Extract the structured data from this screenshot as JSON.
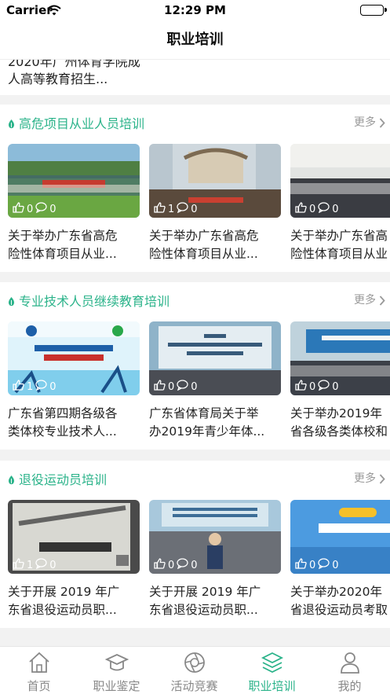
{
  "status_bar": {
    "carrier": "Carrier",
    "time": "12:29 PM"
  },
  "navbar": {
    "title": "职业培训"
  },
  "top_card": {
    "text": "2020年广州体育学院成人高等教育招生..."
  },
  "more_label": "更多",
  "sections": [
    {
      "title": "高危项目从业人员培训",
      "cards": [
        {
          "likes": "0",
          "comments": "0",
          "caption_1": "关于举办广东省高危",
          "caption_2": "险性体育项目从业..."
        },
        {
          "likes": "1",
          "comments": "0",
          "caption_1": "关于举办广东省高危",
          "caption_2": "险性体育项目从业..."
        },
        {
          "likes": "0",
          "comments": "0",
          "caption_1": "关于举办广东省高",
          "caption_2": "险性体育项目从业"
        }
      ]
    },
    {
      "title": "专业技术人员继续教育培训",
      "cards": [
        {
          "likes": "1",
          "comments": "0",
          "caption_1": "广东省第四期各级各",
          "caption_2": "类体校专业技术人..."
        },
        {
          "likes": "0",
          "comments": "0",
          "caption_1": "广东省体育局关于举",
          "caption_2": "办2019年青少年体..."
        },
        {
          "likes": "0",
          "comments": "0",
          "caption_1": "关于举办2019年",
          "caption_2": "省各级各类体校和"
        }
      ]
    },
    {
      "title": "退役运动员培训",
      "cards": [
        {
          "likes": "1",
          "comments": "0",
          "caption_1": "关于开展 2019 年广",
          "caption_2": "东省退役运动员职..."
        },
        {
          "likes": "0",
          "comments": "0",
          "caption_1": "关于开展 2019 年广",
          "caption_2": "东省退役运动员职..."
        },
        {
          "likes": "0",
          "comments": "0",
          "caption_1": "关于举办2020年",
          "caption_2": "省退役运动员考取"
        }
      ]
    }
  ],
  "tabs": [
    {
      "label": "首页",
      "icon": "home-icon",
      "active": false
    },
    {
      "label": "职业鉴定",
      "icon": "mortarboard-icon",
      "active": false
    },
    {
      "label": "活动竞赛",
      "icon": "aperture-icon",
      "active": false
    },
    {
      "label": "职业培训",
      "icon": "layers-icon",
      "active": true
    },
    {
      "label": "我的",
      "icon": "person-icon",
      "active": false
    }
  ],
  "colors": {
    "accent": "#2bb38a",
    "inactive": "#888888"
  }
}
